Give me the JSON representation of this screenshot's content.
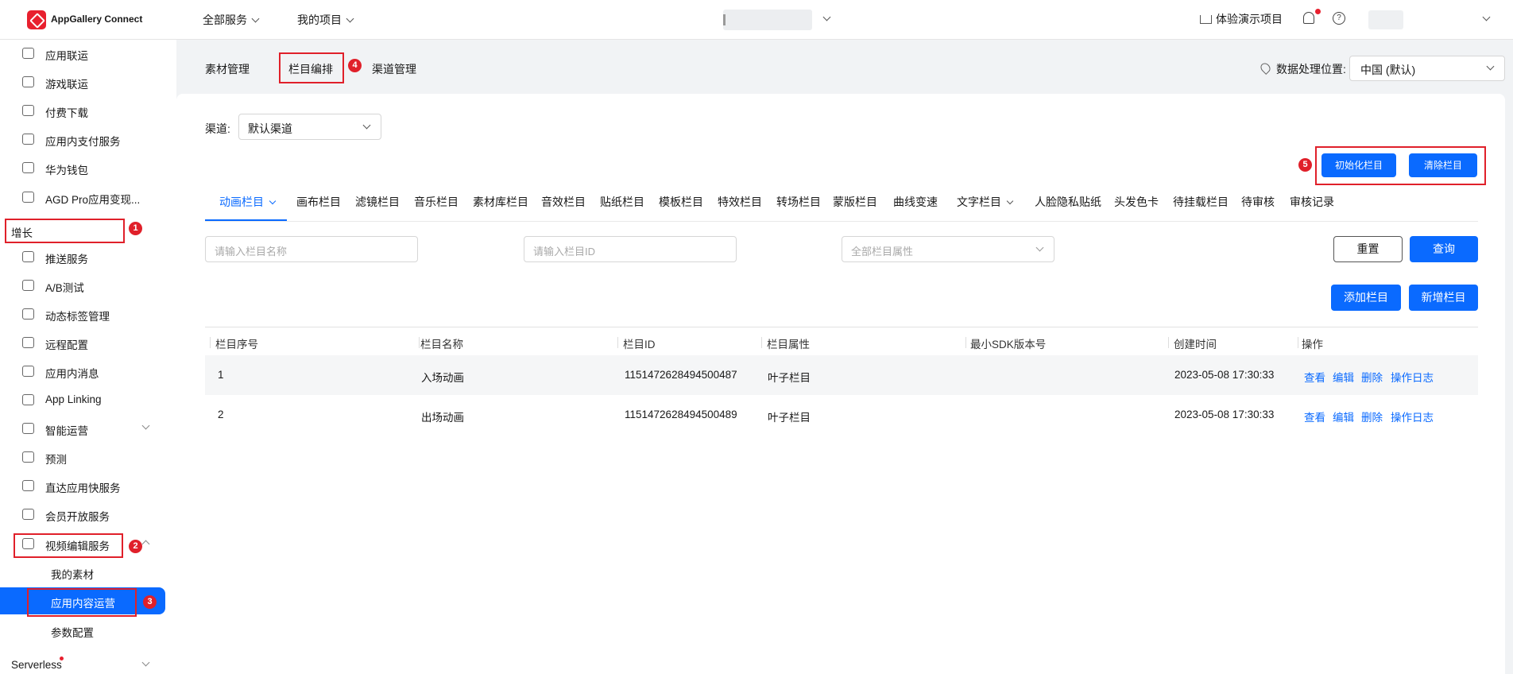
{
  "header": {
    "brand": "AppGallery Connect",
    "nav_all_services": "全部服务",
    "nav_my_projects": "我的项目",
    "demo_project": "体验演示项目"
  },
  "sidebar": {
    "items_top": [
      {
        "label": "应用联运",
        "icon": "app-joint-icon"
      },
      {
        "label": "游戏联运",
        "icon": "game-joint-icon"
      },
      {
        "label": "付费下载",
        "icon": "paid-download-icon"
      },
      {
        "label": "应用内支付服务",
        "icon": "iap-icon"
      },
      {
        "label": "华为钱包",
        "icon": "wallet-icon"
      },
      {
        "label": "AGD Pro应用变现...",
        "icon": "agd-icon"
      }
    ],
    "group_growth": "增长",
    "items_growth": [
      {
        "label": "推送服务",
        "icon": "push-icon"
      },
      {
        "label": "A/B测试",
        "icon": "ab-test-icon"
      },
      {
        "label": "动态标签管理",
        "icon": "tag-icon"
      },
      {
        "label": "远程配置",
        "icon": "remote-config-icon"
      },
      {
        "label": "应用内消息",
        "icon": "message-icon"
      },
      {
        "label": "App Linking",
        "icon": "link-icon"
      },
      {
        "label": "智能运营",
        "icon": "smart-ops-icon"
      },
      {
        "label": "预测",
        "icon": "predict-icon"
      },
      {
        "label": "直达应用快服务",
        "icon": "quick-service-icon"
      },
      {
        "label": "会员开放服务",
        "icon": "member-icon"
      },
      {
        "label": "视频编辑服务",
        "icon": "video-edit-icon"
      }
    ],
    "sub_items": [
      "我的素材",
      "应用内容运营",
      "参数配置"
    ],
    "group_serverless": "Serverless"
  },
  "subnav": {
    "items": [
      "素材管理",
      "栏目编排",
      "渠道管理"
    ],
    "region_label": "数据处理位置:",
    "region_value": "中国 (默认)"
  },
  "channel": {
    "label": "渠道:",
    "value": "默认渠道"
  },
  "buttons": {
    "init_column": "初始化栏目",
    "clear_column": "清除栏目",
    "reset": "重置",
    "query": "查询",
    "add_column": "添加栏目",
    "new_column": "新增栏目"
  },
  "tabs": [
    "动画栏目",
    "画布栏目",
    "滤镜栏目",
    "音乐栏目",
    "素材库栏目",
    "音效栏目",
    "贴纸栏目",
    "模板栏目",
    "特效栏目",
    "转场栏目",
    "蒙版栏目",
    "曲线变速",
    "文字栏目",
    "人脸隐私贴纸",
    "头发色卡",
    "待挂载栏目",
    "待审核",
    "审核记录"
  ],
  "filters": {
    "name_placeholder": "请输入栏目名称",
    "id_placeholder": "请输入栏目ID",
    "attr_placeholder": "全部栏目属性"
  },
  "table": {
    "headers": [
      "栏目序号",
      "栏目名称",
      "栏目ID",
      "栏目属性",
      "最小SDK版本号",
      "创建时间",
      "操作"
    ],
    "rows": [
      {
        "seq": "1",
        "name": "入场动画",
        "id": "1151472628494500487",
        "attr": "叶子栏目",
        "sdk": "",
        "created": "2023-05-08 17:30:33"
      },
      {
        "seq": "2",
        "name": "出场动画",
        "id": "1151472628494500489",
        "attr": "叶子栏目",
        "sdk": "",
        "created": "2023-05-08 17:30:33"
      }
    ],
    "actions": [
      "查看",
      "编辑",
      "删除",
      "操作日志"
    ]
  },
  "annotations": [
    "1",
    "2",
    "3",
    "4",
    "5"
  ],
  "colors": {
    "accent": "#0a6aff",
    "annotation_red": "#e0202a",
    "brand_red": "#e8202e"
  }
}
